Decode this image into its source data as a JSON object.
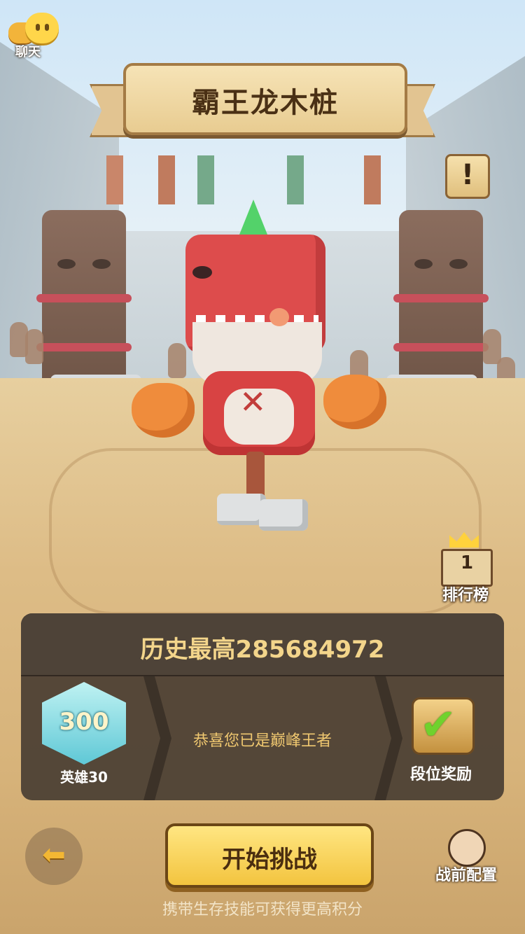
{
  "chat": {
    "label": "聊天"
  },
  "title": {
    "text": "霸王龙木桩"
  },
  "notice": {
    "symbol": "!"
  },
  "leaderboard": {
    "rank": "1",
    "label": "排行榜"
  },
  "stats": {
    "best_label": "历史最高285684972",
    "badge_number": "300",
    "badge_label": "英雄30",
    "congrats": "恭喜您已是巅峰王者",
    "reward_label": "段位奖励"
  },
  "controls": {
    "back_icon": "arrow-left-icon",
    "start_label": "开始挑战",
    "prep_label": "战前配置"
  },
  "hint": "携带生存技能可获得更高积分",
  "colors": {
    "accent_gold": "#f3c43f",
    "panel_bg": "#42382f",
    "best_text": "#f3d58b",
    "congrats_text": "#f0c870",
    "check_green": "#6fd22d"
  }
}
